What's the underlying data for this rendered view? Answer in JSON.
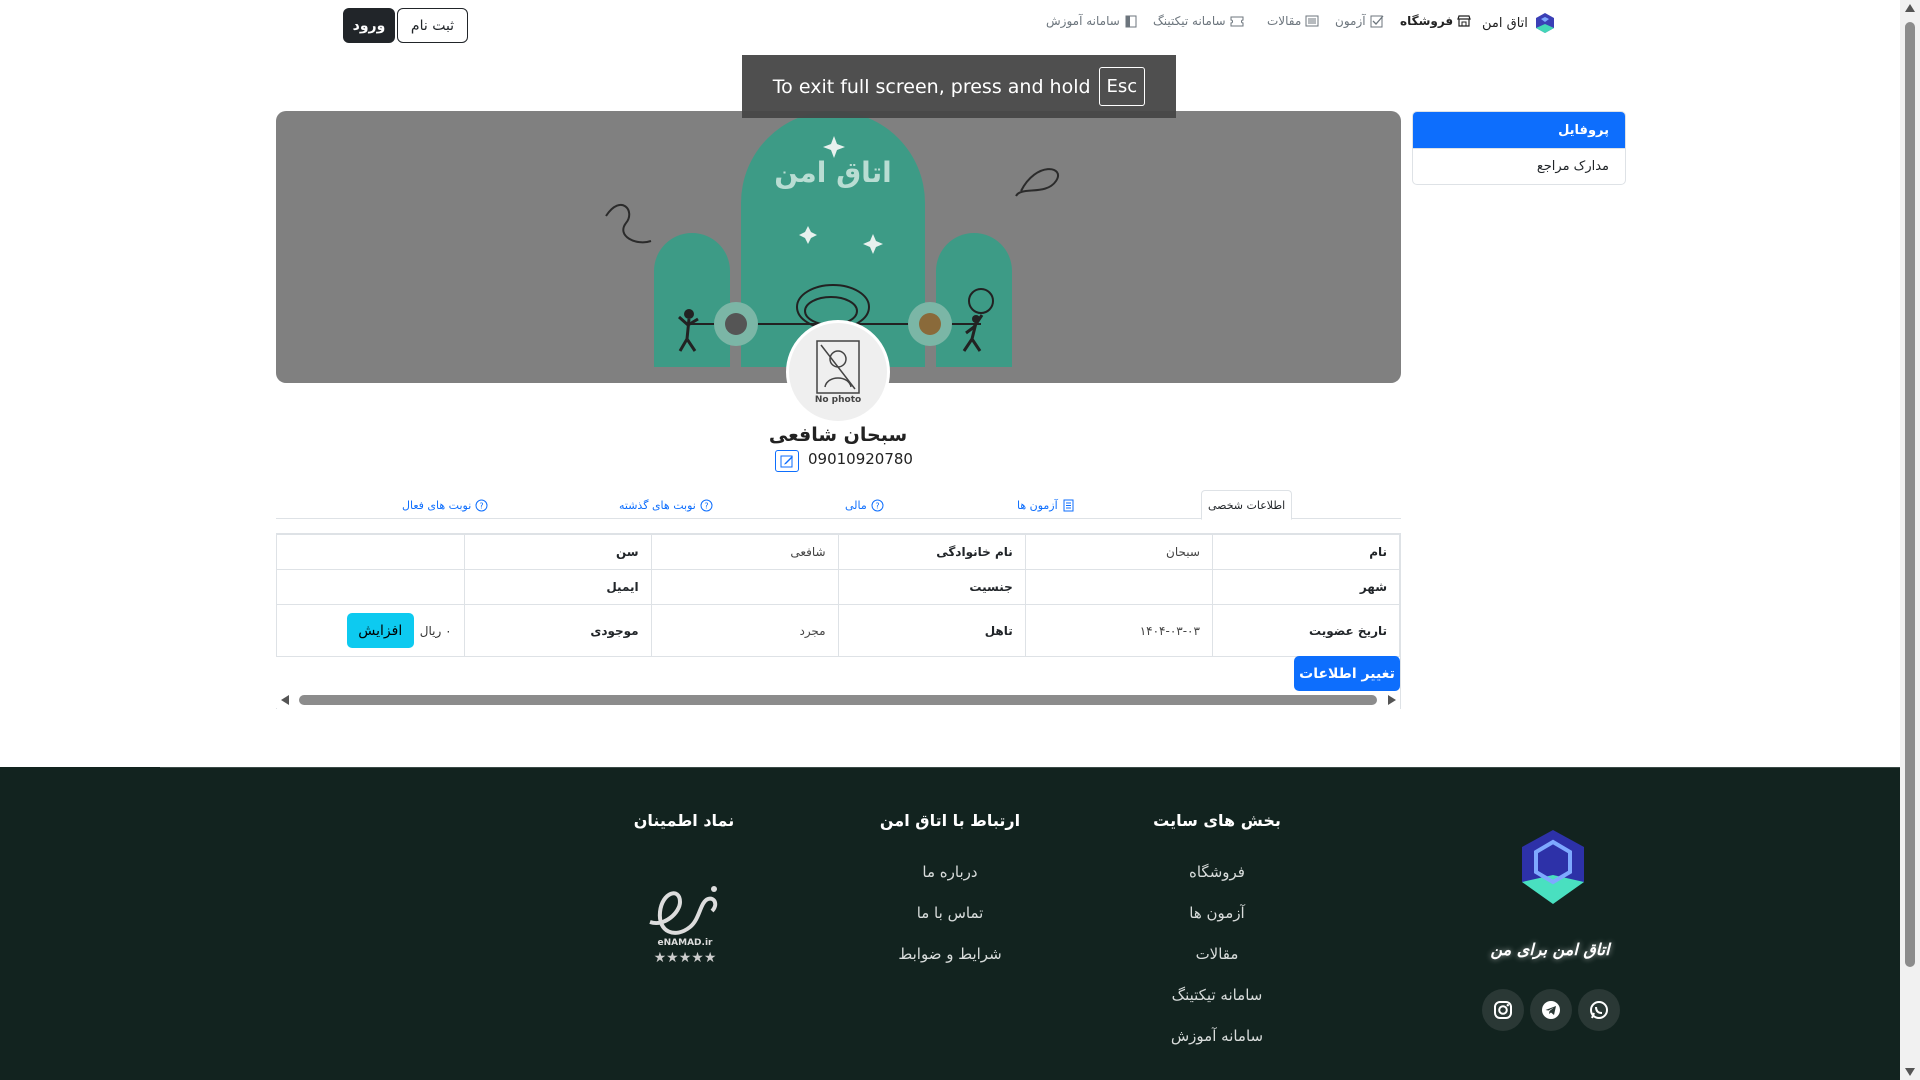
{
  "header": {
    "brand": "اتاق امن",
    "nav": [
      {
        "label": "فروشگاه",
        "icon": "shop-icon",
        "active": true
      },
      {
        "label": "آزمون",
        "icon": "checkbox-icon",
        "active": false
      },
      {
        "label": "مقالات",
        "icon": "newspaper-icon",
        "active": false
      },
      {
        "label": "سامانه تیکتینگ",
        "icon": "ticket-icon",
        "active": false
      },
      {
        "label": "سامانه آموزش",
        "icon": "book-icon",
        "active": false
      }
    ],
    "login_label": "ورود",
    "signup_label": "ثبت نام"
  },
  "fullscreen_toast": {
    "text": "To exit full screen, press and hold",
    "key": "Esc"
  },
  "sidebar": {
    "items": [
      {
        "label": "پروفایل",
        "active": true
      },
      {
        "label": "مدارک مراجع",
        "active": false
      }
    ]
  },
  "banner": {
    "title": "اتاق امن"
  },
  "profile": {
    "avatar_text": "No photo",
    "name": "سبحان شافعی",
    "phone": "09010920780"
  },
  "tabs": [
    {
      "label": "اطلاعات شخصی",
      "active": true
    },
    {
      "label": "آزمون ها",
      "active": false
    },
    {
      "label": "مالی",
      "active": false
    },
    {
      "label": "نوبت های گذشته",
      "active": false
    },
    {
      "label": "نوبت های فعال",
      "active": false
    }
  ],
  "info_table": {
    "rows": [
      [
        "نام",
        "سبحان",
        "نام خانوادگی",
        "شافعی",
        "سن",
        ""
      ],
      [
        "شهر",
        "",
        "جنسیت",
        "",
        "ایمیل",
        ""
      ],
      [
        "تاریخ عضویت",
        "۱۴۰۴-۰۳-۰۳",
        "تاهل",
        "مجرد",
        "موجودی",
        ""
      ]
    ],
    "balance": "۰ ریال",
    "increase_label": "افزایش"
  },
  "change_info_label": "تغییر اطلاعات",
  "footer": {
    "sections_title": "بخش های سایت",
    "sections": [
      "فروشگاه",
      "آزمون ها",
      "مقالات",
      "سامانه تیکتینگ",
      "سامانه آموزش"
    ],
    "contact_title": "ارتباط با اتاق امن",
    "contact": [
      "درباره ما",
      "تماس با ما",
      "شرایط و ضوابط"
    ],
    "trust_title": "نماد اطمینان",
    "enamad_text": "eNAMAD.ir",
    "tagline": "اتاق امن برای من"
  },
  "colors": {
    "primary": "#0d6efd",
    "info": "#0dcaf0",
    "dark": "#212529",
    "footer_bg": "#12231f",
    "banner_bg": "#808080",
    "banner_teal": "#3d9b86"
  }
}
